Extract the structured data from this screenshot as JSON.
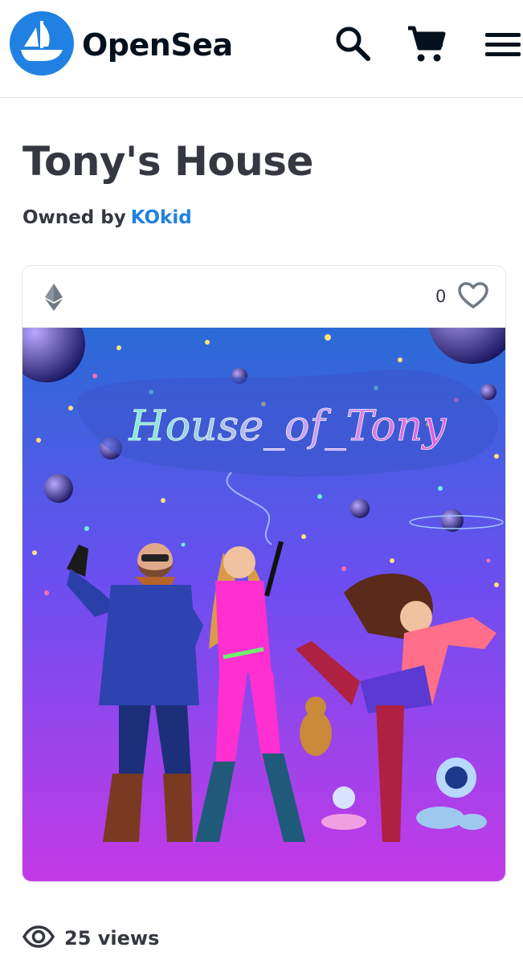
{
  "header": {
    "brand": "OpenSea",
    "logo_icon": "opensea-logo-icon",
    "search_icon": "search-icon",
    "cart_icon": "cart-icon",
    "menu_icon": "menu-icon"
  },
  "item": {
    "title": "Tony's House",
    "owned_by_label": "Owned by",
    "owner": "KOkid",
    "chain_icon": "ethereum-icon",
    "favorites": "0",
    "favorite_icon": "heart-icon",
    "artwork_text": "House_of_Tony",
    "views": "25 views",
    "views_icon": "eye-icon"
  },
  "colors": {
    "accent": "#2081e2",
    "text": "#353840",
    "artwork_top": "#2a6bd6",
    "artwork_bottom": "#c43ae6"
  }
}
